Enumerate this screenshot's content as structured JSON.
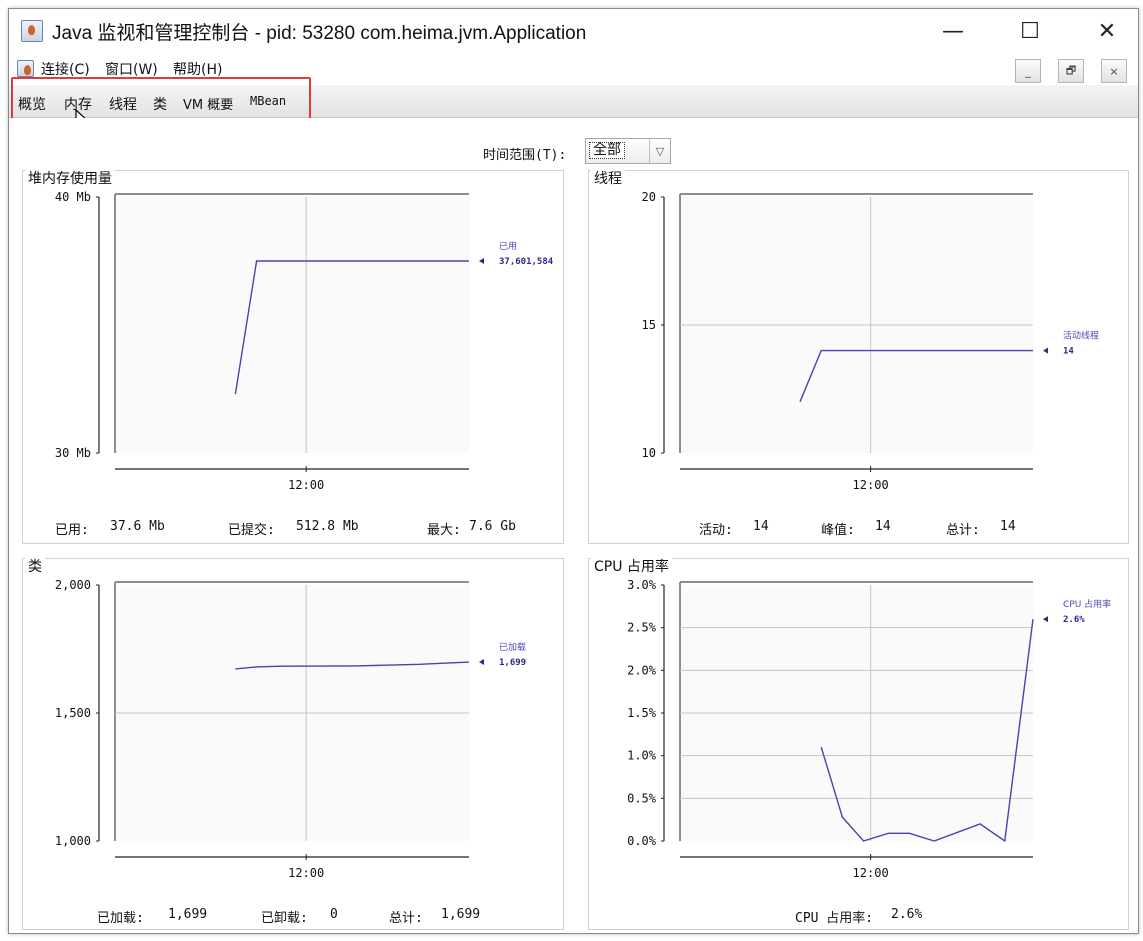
{
  "window": {
    "title": "Java 监视和管理控制台 - pid: 53280 com.heima.jvm.Application",
    "buttons": {
      "minimize": "—",
      "maximize": "☐",
      "close": "✕"
    }
  },
  "menubar": {
    "items": [
      {
        "label": "连接(C)"
      },
      {
        "label": "窗口(W)"
      },
      {
        "label": "帮助(H)"
      }
    ],
    "mdi": {
      "minimize": "_",
      "restore": "🗗",
      "close": "×"
    }
  },
  "tabs": [
    {
      "label": "概览",
      "active": true
    },
    {
      "label": "内存"
    },
    {
      "label": "线程"
    },
    {
      "label": "类"
    },
    {
      "label": "VM 概要"
    },
    {
      "label": "MBean"
    }
  ],
  "time_range": {
    "label": "时间范围(T):",
    "value": "全部"
  },
  "panels": {
    "heap": {
      "title": "堆内存使用量",
      "stats": {
        "used_label": "已用:",
        "used_value": "37.6 Mb",
        "committed_label": "已提交:",
        "committed_value": "512.8 Mb",
        "max_label": "最大:",
        "max_value": "7.6 Gb"
      }
    },
    "threads": {
      "title": "线程",
      "stats": {
        "active_label": "活动:",
        "active_value": "14",
        "peak_label": "峰值:",
        "peak_value": "14",
        "total_label": "总计:",
        "total_value": "14"
      }
    },
    "classes": {
      "title": "类",
      "stats": {
        "loaded_label": "已加载:",
        "loaded_value": "1,699",
        "unloaded_label": "已卸载:",
        "unloaded_value": "0",
        "total_label": "总计:",
        "total_value": "1,699"
      }
    },
    "cpu": {
      "title": "CPU 占用率",
      "stats": {
        "label": "CPU 占用率:",
        "value": "2.6%"
      }
    }
  },
  "chart_data": [
    {
      "id": "heap",
      "type": "line",
      "title": "堆内存使用量",
      "y_tick_labels": [
        "40 Mb",
        "30 Mb"
      ],
      "ylim": [
        30,
        40
      ],
      "x_tick_labels": [
        "12:00"
      ],
      "x_range": [
        0,
        100
      ],
      "series": [
        {
          "name": "已用",
          "legend_value": "37,601,584",
          "x": [
            34,
            40,
            100
          ],
          "y": [
            32.3,
            37.5,
            37.5
          ]
        }
      ],
      "color": "#4444b4"
    },
    {
      "id": "threads",
      "type": "line",
      "title": "线程",
      "y_tick_labels": [
        "20",
        "15",
        "10"
      ],
      "ylim": [
        10,
        20
      ],
      "y_ticks": [
        20,
        15,
        10
      ],
      "x_tick_labels": [
        "12:00"
      ],
      "x_range": [
        0,
        100
      ],
      "series": [
        {
          "name": "活动线程",
          "legend_value": "14",
          "x": [
            34,
            40,
            100
          ],
          "y": [
            12.0,
            14.0,
            14.0
          ]
        }
      ],
      "color": "#4444b4"
    },
    {
      "id": "classes",
      "type": "line",
      "title": "类",
      "y_tick_labels": [
        "2,000",
        "1,500",
        "1,000"
      ],
      "ylim": [
        1000,
        2000
      ],
      "y_ticks": [
        2000,
        1500,
        1000
      ],
      "x_tick_labels": [
        "12:00"
      ],
      "x_range": [
        0,
        100
      ],
      "series": [
        {
          "name": "已加载",
          "legend_value": "1,699",
          "x": [
            34,
            40,
            47,
            68,
            86,
            100
          ],
          "y": [
            1672,
            1680,
            1683,
            1684,
            1690,
            1699
          ]
        }
      ],
      "color": "#4444b4"
    },
    {
      "id": "cpu",
      "type": "line",
      "title": "CPU 占用率",
      "y_tick_labels": [
        "3.0%",
        "2.5%",
        "2.0%",
        "1.5%",
        "1.0%",
        "0.5%",
        "0.0%"
      ],
      "ylim": [
        0,
        3.0
      ],
      "y_ticks": [
        3.0,
        2.5,
        2.0,
        1.5,
        1.0,
        0.5,
        0.0
      ],
      "x_tick_labels": [
        "12:00"
      ],
      "x_range": [
        0,
        100
      ],
      "series": [
        {
          "name": "CPU 占用率",
          "legend_value": "2.6%",
          "x": [
            40,
            46,
            52,
            59,
            65,
            72,
            85,
            92,
            100
          ],
          "y": [
            1.1,
            0.28,
            0.0,
            0.09,
            0.09,
            0.0,
            0.2,
            0.0,
            2.6
          ]
        }
      ],
      "color": "#4444b4"
    }
  ]
}
